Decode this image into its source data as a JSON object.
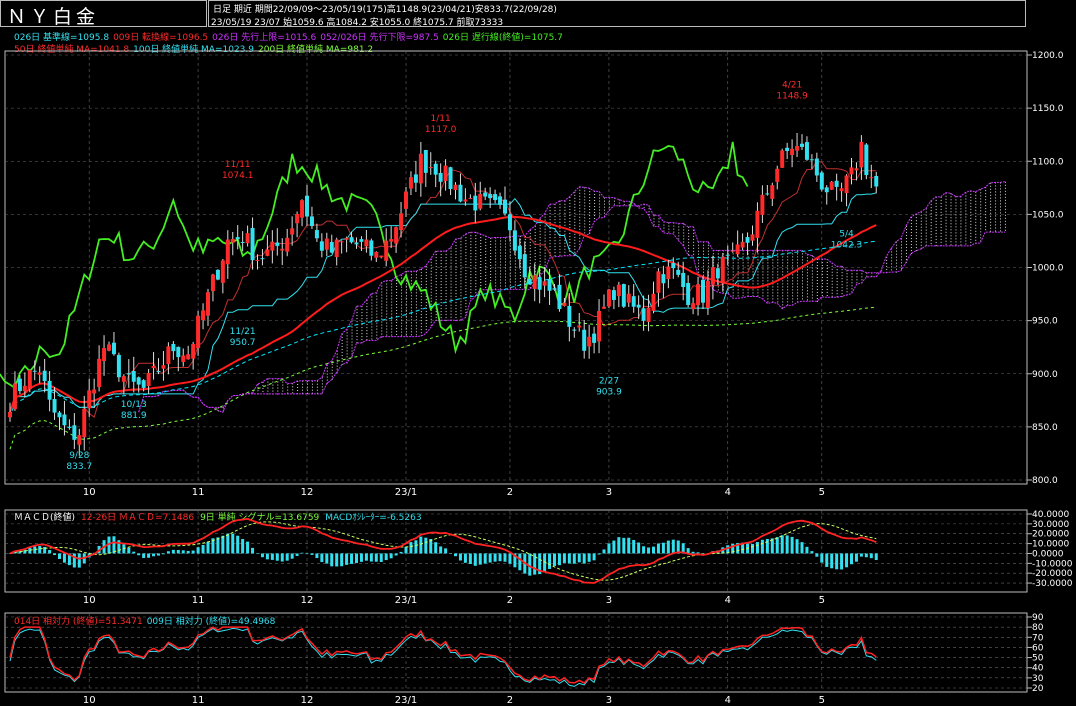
{
  "header": {
    "title": "ＮＹ白金",
    "line1": "日足  期近  期間22/09/09～23/05/19(175)高1148.9(23/04/21)安833.7(22/09/28)",
    "line2": "23/05/19 23/07 始1059.6 高1084.2 安1055.0 終1075.7 前取73333"
  },
  "colors": {
    "up": "#ff2a2a",
    "down": "#33e0f0",
    "ma50": "#ff1c1c",
    "ma100": "#00e8ff",
    "ma200": "#7cff3c",
    "chikou": "#44ee22",
    "kijun": "#ff66aa",
    "tenkan": "#c03030",
    "cloud": "#cc33ff",
    "macd": "#ff2222",
    "signal": "#ccff66",
    "hist": "#33e0f0",
    "rsi": "#ff2222"
  },
  "legends": {
    "row1": [
      {
        "text": "026日 基準線=1095.8",
        "color": "#33e0f0"
      },
      {
        "text": "009日 転換線=1096.5",
        "color": "#ff2a2a"
      },
      {
        "text": "026日 先行上限=1015.6",
        "color": "#cc33ff"
      },
      {
        "text": "052/026日 先行下限=987.5",
        "color": "#cc33ff"
      },
      {
        "text": "026日 遅行線(終値)=1075.7",
        "color": "#44ee22"
      }
    ],
    "row2": [
      {
        "text": "50日 終値単純 MA=1041.8",
        "color": "#ff2a2a"
      },
      {
        "text": "100日 終値単純 MA=1023.9",
        "color": "#33e0f0"
      },
      {
        "text": "200日 終値単純 MA=981.2",
        "color": "#7cff3c"
      }
    ],
    "macd": [
      {
        "text": "ＭＡＣＤ(終値)",
        "color": "#ffffff"
      },
      {
        "text": "12-26日 ＭＡＣＤ=7.1486",
        "color": "#ff2a2a"
      },
      {
        "text": "9日 単純 シグナル=13.6759",
        "color": "#7cff3c"
      },
      {
        "text": "MACDｵｼﾚｰﾀｰ=-6.5263",
        "color": "#33e0f0"
      }
    ],
    "rsi": [
      {
        "text": "014日 相対力 (終値)=51.3471",
        "color": "#ff2a2a"
      },
      {
        "text": "009日 相対力 (終値)=49.4968",
        "color": "#33e0f0"
      }
    ]
  },
  "chart_data": {
    "type": "candlestick",
    "price_axis": {
      "ylim": [
        800,
        1200
      ],
      "ticks": [
        "800.0",
        "850.0",
        "900.0",
        "950.0",
        "1000.0",
        "1050.0",
        "1100.0",
        "1150.0",
        "1200.0"
      ]
    },
    "macd_axis": {
      "ylim": [
        -35,
        40
      ],
      "ticks": [
        "-30.0000",
        "-20.0000",
        "-10.0000",
        "0.0000",
        "10.0000",
        "20.0000",
        "30.0000",
        "40.0000"
      ]
    },
    "rsi_axis": {
      "ylim": [
        20,
        90
      ],
      "ticks": [
        "20",
        "30",
        "40",
        "50",
        "60",
        "70",
        "80",
        "90"
      ]
    },
    "x_labels": [
      {
        "label": "10",
        "index": 16
      },
      {
        "label": "11",
        "index": 38
      },
      {
        "label": "12",
        "index": 60
      },
      {
        "label": "23/1",
        "index": 80
      },
      {
        "label": "2",
        "index": 101
      },
      {
        "label": "3",
        "index": 121
      },
      {
        "label": "4",
        "index": 145
      },
      {
        "label": "5",
        "index": 164
      }
    ],
    "closes_anchor": [
      [
        0,
        875
      ],
      [
        3,
        895
      ],
      [
        6,
        905
      ],
      [
        8,
        870
      ],
      [
        10,
        855
      ],
      [
        12,
        842
      ],
      [
        14,
        845
      ],
      [
        16,
        880
      ],
      [
        19,
        925
      ],
      [
        22,
        905
      ],
      [
        24,
        890
      ],
      [
        27,
        885
      ],
      [
        30,
        905
      ],
      [
        33,
        925
      ],
      [
        36,
        920
      ],
      [
        38,
        945
      ],
      [
        41,
        985
      ],
      [
        44,
        1025
      ],
      [
        47,
        1030
      ],
      [
        50,
        1010
      ],
      [
        53,
        1015
      ],
      [
        56,
        1030
      ],
      [
        59,
        1065
      ],
      [
        62,
        1025
      ],
      [
        65,
        1015
      ],
      [
        68,
        1025
      ],
      [
        71,
        1020
      ],
      [
        74,
        1010
      ],
      [
        77,
        1030
      ],
      [
        80,
        1065
      ],
      [
        83,
        1100
      ],
      [
        86,
        1095
      ],
      [
        89,
        1080
      ],
      [
        92,
        1065
      ],
      [
        95,
        1060
      ],
      [
        98,
        1055
      ],
      [
        101,
        1040
      ],
      [
        104,
        1000
      ],
      [
        107,
        985
      ],
      [
        110,
        975
      ],
      [
        113,
        950
      ],
      [
        116,
        930
      ],
      [
        118,
        940
      ],
      [
        120,
        960
      ],
      [
        122,
        980
      ],
      [
        125,
        965
      ],
      [
        128,
        955
      ],
      [
        131,
        995
      ],
      [
        134,
        995
      ],
      [
        137,
        975
      ],
      [
        140,
        975
      ],
      [
        143,
        1000
      ],
      [
        146,
        1005
      ],
      [
        149,
        1025
      ],
      [
        152,
        1060
      ],
      [
        155,
        1095
      ],
      [
        158,
        1115
      ],
      [
        161,
        1105
      ],
      [
        164,
        1080
      ],
      [
        167,
        1065
      ],
      [
        170,
        1085
      ],
      [
        172,
        1115
      ],
      [
        173,
        1095
      ],
      [
        175,
        1075
      ]
    ],
    "n_bars": 176,
    "annotations": [
      {
        "index": 14,
        "value": 833.7,
        "text": "9/28",
        "text2": "833.7",
        "pos": "below",
        "color": "#33e0f0"
      },
      {
        "index": 25,
        "value": 881.9,
        "text": "10/13",
        "text2": "881.9",
        "pos": "below",
        "color": "#33e0f0"
      },
      {
        "index": 46,
        "value": 1074.1,
        "text": "11/11",
        "text2": "1074.1",
        "pos": "above",
        "color": "#ff2a2a"
      },
      {
        "index": 47,
        "value": 950.7,
        "text": "11/21",
        "text2": "950.7",
        "pos": "below",
        "color": "#33e0f0"
      },
      {
        "index": 87,
        "value": 1117.0,
        "text": "1/11",
        "text2": "1117.0",
        "pos": "above",
        "color": "#ff2a2a"
      },
      {
        "index": 121,
        "value": 903.9,
        "text": "2/27",
        "text2": "903.9",
        "pos": "below",
        "color": "#33e0f0"
      },
      {
        "index": 158,
        "value": 1148.9,
        "text": "4/21",
        "text2": "1148.9",
        "pos": "above",
        "color": "#ff2a2a"
      },
      {
        "index": 169,
        "value": 1042.3,
        "text": "5/4",
        "text2": "1042.3",
        "pos": "below",
        "color": "#33e0f0"
      }
    ]
  }
}
